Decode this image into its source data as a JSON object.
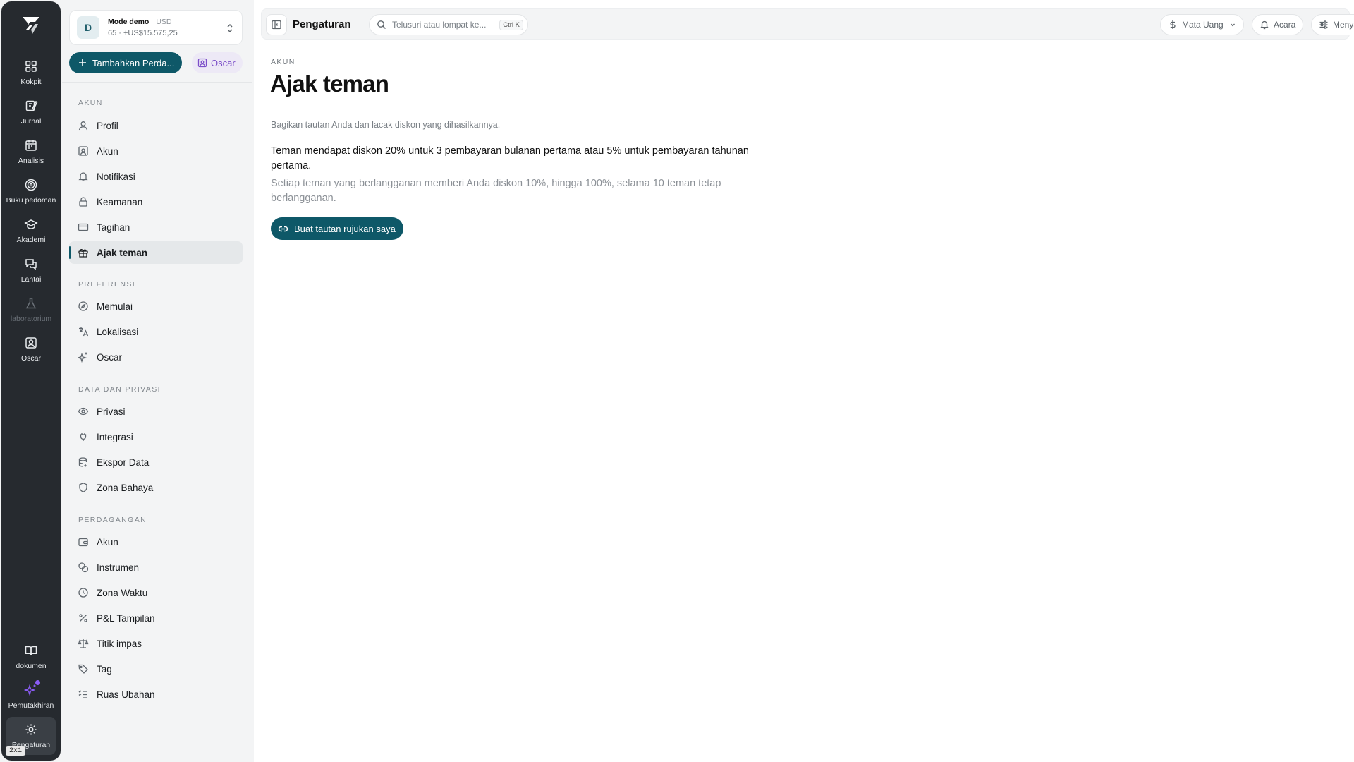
{
  "rail": {
    "items": [
      {
        "label": "Kokpit",
        "icon": "dashboard-icon"
      },
      {
        "label": "Jurnal",
        "icon": "journal-icon"
      },
      {
        "label": "Analisis",
        "icon": "calendar-icon"
      },
      {
        "label": "Buku pedoman",
        "icon": "target-icon"
      },
      {
        "label": "Akademi",
        "icon": "graduation-cap-icon"
      },
      {
        "label": "Lantai",
        "icon": "chat-icon"
      },
      {
        "label": "laboratorium",
        "icon": "flask-icon"
      },
      {
        "label": "Oscar",
        "icon": "contact-card-icon"
      }
    ],
    "bottom": [
      {
        "label": "dokumen",
        "icon": "book-open-icon"
      },
      {
        "label": "Pemutakhiran",
        "icon": "sparkles-icon"
      },
      {
        "label": "Pengaturan",
        "icon": "gear-icon"
      }
    ],
    "badge": "2x1"
  },
  "account": {
    "avatar": "D",
    "mode": "Mode demo",
    "currency": "USD",
    "summary": "65 · +US$15.575,25"
  },
  "sidebar": {
    "add_button": "Tambahkan Perda...",
    "oscar_button": "Oscar",
    "sections": [
      {
        "title": "AKUN",
        "items": [
          "Profil",
          "Akun",
          "Notifikasi",
          "Keamanan",
          "Tagihan",
          "Ajak teman"
        ]
      },
      {
        "title": "PREFERENSI",
        "items": [
          "Memulai",
          "Lokalisasi",
          "Oscar"
        ]
      },
      {
        "title": "DATA DAN PRIVASI",
        "items": [
          "Privasi",
          "Integrasi",
          "Ekspor Data",
          "Zona Bahaya"
        ]
      },
      {
        "title": "PERDAGANGAN",
        "items": [
          "Akun",
          "Instrumen",
          "Zona Waktu",
          "P&L Tampilan",
          "Titik impas",
          "Tag",
          "Ruas Ubahan"
        ]
      }
    ],
    "active_item": "Ajak teman"
  },
  "topbar": {
    "title": "Pengaturan",
    "search_placeholder": "Telusuri atau lompat ke...",
    "shortcut": "Ctrl K",
    "currency_button": "Mata Uang",
    "events_button": "Acara",
    "filter_button": "Menyaring"
  },
  "content": {
    "crumb": "AKUN",
    "title": "Ajak teman",
    "subtitle": "Bagikan tautan Anda dan lacak diskon yang dihasilkannya.",
    "primary_text": "Teman mendapat diskon 20% untuk 3 pembayaran bulanan pertama atau 5% untuk pembayaran tahunan pertama.",
    "secondary_text": "Setiap teman yang berlangganan memberi Anda diskon 10%, hingga 100%, selama 10 teman tetap berlangganan.",
    "cta": "Buat tautan rujukan saya"
  },
  "colors": {
    "accent": "#0e5868",
    "rail": "#262a2f",
    "oscar": "#7c4fc9"
  }
}
